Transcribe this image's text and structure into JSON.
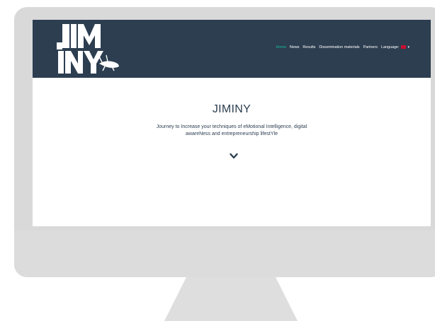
{
  "site": {
    "logo_text": "JIMINY",
    "nav": [
      {
        "label": "Home",
        "active": true
      },
      {
        "label": "News"
      },
      {
        "label": "Results"
      },
      {
        "label": "Dissemination materials"
      },
      {
        "label": "Partners"
      },
      {
        "label": "Language:"
      }
    ],
    "accent_color": "#18bc9c",
    "header_color": "#2c3e50"
  },
  "hero": {
    "title": "JIMINY",
    "subtitle_line1": "Journey to Increase your techniques of eMotional Intelligence, digital",
    "subtitle_line2": "awareNess and entrepreneurship lifestYle",
    "scroll_icon": "chevron-down-icon"
  }
}
